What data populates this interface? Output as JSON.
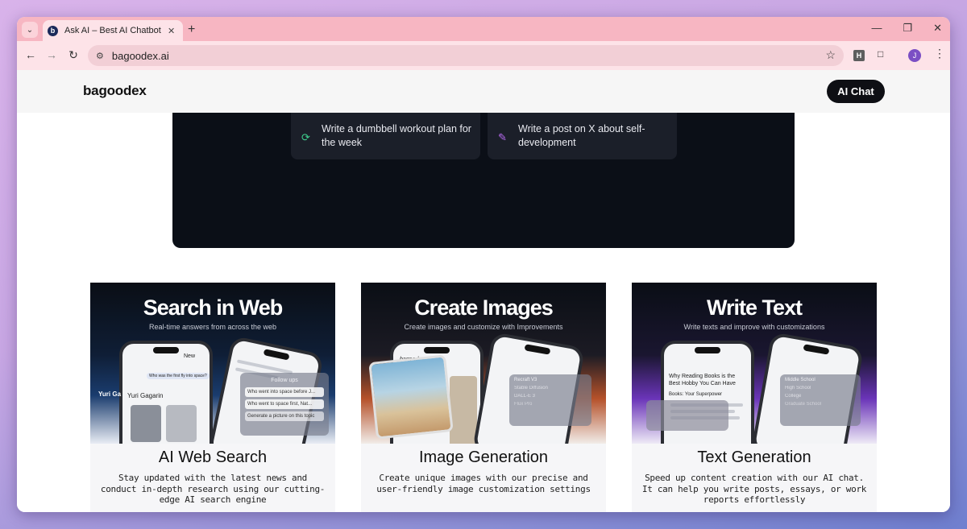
{
  "browser": {
    "tab_title": "Ask AI – Best AI Chatbot and AI",
    "tab_favicon_letter": "b",
    "url": "bagoodex.ai",
    "profile_initial": "J",
    "extension_letter": "H"
  },
  "site": {
    "logo": "bagoodex",
    "ai_chat_label": "AI Chat"
  },
  "prompts": [
    {
      "icon": "dumbbell-icon",
      "text": "Write a dumbbell workout plan for the week"
    },
    {
      "icon": "edit-icon",
      "text": "Write a post on X about self-development"
    }
  ],
  "features": [
    {
      "visual_title": "Search in Web",
      "visual_subtitle": "Real-time answers from across the web",
      "title": "AI Web Search",
      "description": "Stay updated with the latest news and conduct in-depth research using our cutting-edge AI search engine",
      "mock": {
        "new_label": "New",
        "question": "Who was the first fly into space?",
        "answer_name": "Yuri Gagarin",
        "side_name": "Yuri Ga",
        "panel_title": "Follow ups",
        "panel_items": [
          "Who went into space before J...",
          "Who went to space first, Nat...",
          "Generate a picture on this topic"
        ]
      }
    },
    {
      "visual_title": "Create Images",
      "visual_subtitle": "Create images and customize with Improvements",
      "title": "Image Generation",
      "description": "Create unique images with our precise and user-friendly image customization settings",
      "mock": {
        "brand": "bagoodex",
        "panel_title": "Improvements",
        "panel_items": [
          "Recraft V3",
          "Stable Diffusion",
          "DALL-E 3",
          "Flux Pro"
        ]
      }
    },
    {
      "visual_title": "Write Text",
      "visual_subtitle": "Write texts and improve with customizations",
      "title": "Text Generation",
      "description": "Speed up content creation with our AI chat. It can help you write posts, essays, or work reports effortlessly",
      "mock": {
        "article_title": "Why Reading Books is the Best Hobby You Can Have",
        "article_sub": "Books: Your Superpower",
        "panel_title": "Improvements",
        "panel_items": [
          "Middle School",
          "High School",
          "College",
          "Graduate School"
        ]
      }
    }
  ]
}
